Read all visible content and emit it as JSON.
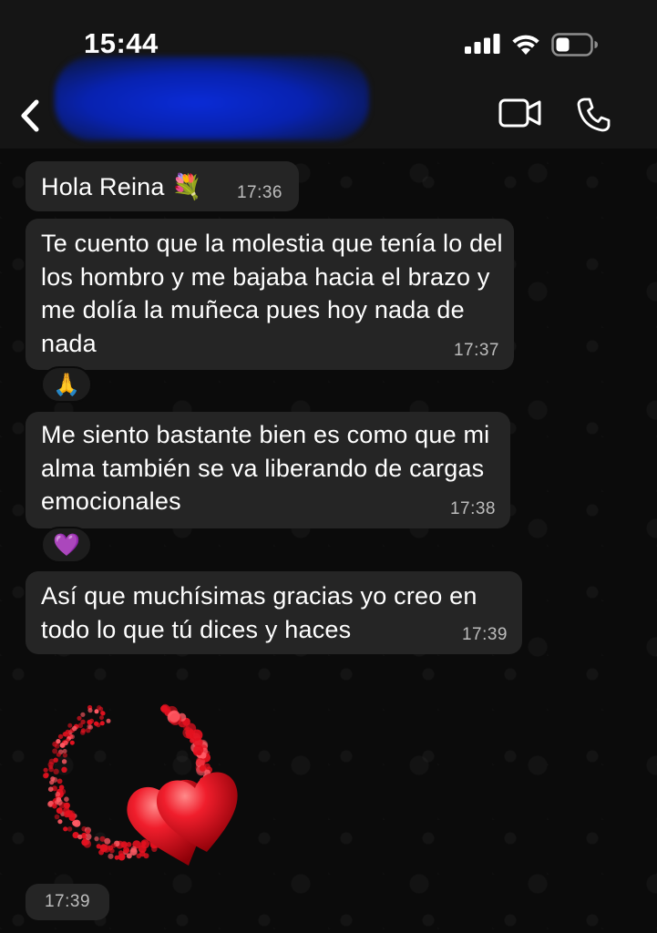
{
  "status_bar": {
    "time": "15:44"
  },
  "header": {
    "contact_name_hidden": true,
    "icons": {
      "back": "chevron-left-icon",
      "video": "video-camera-icon",
      "call": "phone-icon"
    }
  },
  "messages": [
    {
      "text": "Hola Reina 💐",
      "time": "17:36"
    },
    {
      "text": "Te cuento que la molestia que tenía lo del los hombro y   me bajaba hacia el brazo y me dolía la muñeca pues hoy nada de nada",
      "time": "17:37",
      "reaction": "🙏"
    },
    {
      "text": "Me siento bastante bien es como que mi alma también se va liberando de cargas emocionales",
      "time": "17:38",
      "reaction": "💜"
    },
    {
      "text": "Así que muchísimas gracias yo creo en todo lo que tú dices y haces",
      "time": "17:39"
    },
    {
      "sticker": "red-hearts-swirl",
      "time": "17:39"
    }
  ],
  "colors": {
    "bubble": "#252525",
    "background": "#0b0b0b",
    "header": "#151515",
    "timestamp": "#bdbdbd"
  }
}
